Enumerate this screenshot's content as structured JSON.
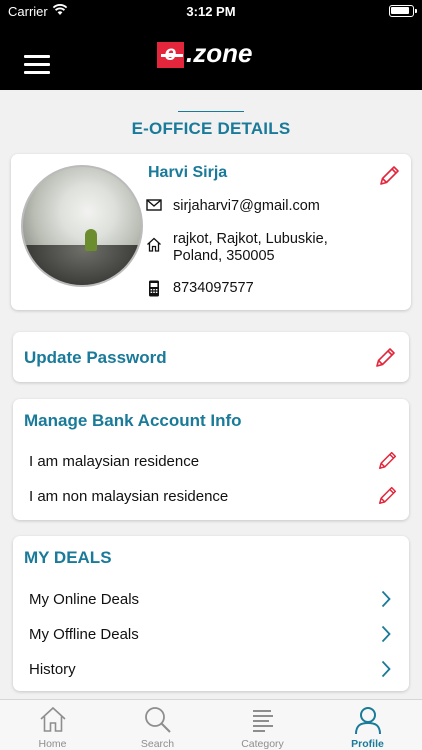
{
  "status_bar": {
    "carrier": "Carrier",
    "time": "3:12 PM"
  },
  "header": {
    "logo_e": "e",
    "logo_text": ".zone"
  },
  "page": {
    "title": "E-OFFICE DETAILS"
  },
  "profile": {
    "name": "Harvi Sirja",
    "email": "sirjaharvi7@gmail.com",
    "address_line1": "rajkot, Rajkot, Lubuskie,",
    "address_line2": "Poland, 350005",
    "phone": "8734097577"
  },
  "password": {
    "label": "Update Password"
  },
  "bank": {
    "title": "Manage Bank Account Info",
    "rows": [
      "I am malaysian residence",
      "I am non malaysian residence"
    ]
  },
  "deals": {
    "title": "MY DEALS",
    "rows": [
      "My Online Deals",
      "My Offline Deals",
      "History"
    ]
  },
  "tabs": [
    {
      "label": "Home",
      "icon": "home-icon"
    },
    {
      "label": "Search",
      "icon": "search-icon"
    },
    {
      "label": "Category",
      "icon": "category-icon"
    },
    {
      "label": "Profile",
      "icon": "profile-icon",
      "active": true
    }
  ],
  "colors": {
    "accent": "#1a7a99",
    "edit": "#e3263b",
    "brand": "#e3263b",
    "header": "#000000"
  }
}
